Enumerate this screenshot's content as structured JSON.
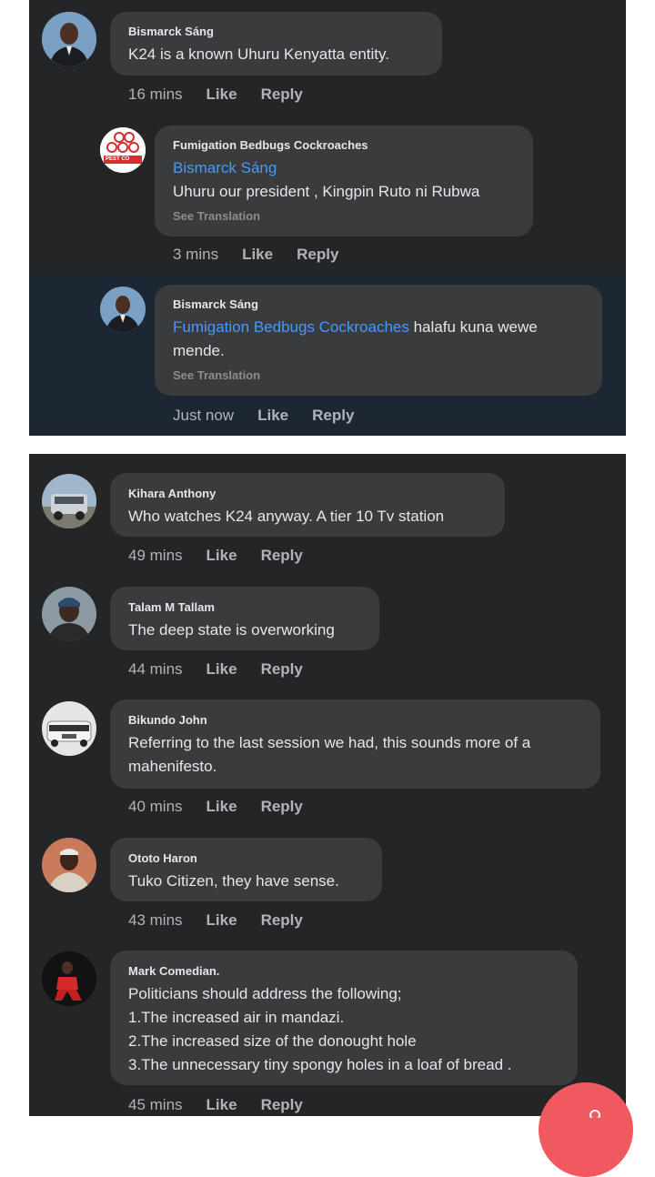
{
  "panel1": {
    "comments": [
      {
        "author": "Bismarck Sáng",
        "text": "K24 is a known Uhuru Kenyatta entity.",
        "time": "16 mins",
        "like": "Like",
        "reply": "Reply"
      },
      {
        "author": "Fumigation Bedbugs Cockroaches",
        "mention": "Bismarck Sáng",
        "text": "Uhuru our president , Kingpin Ruto ni Rubwa",
        "see_translation": "See Translation",
        "time": "3 mins",
        "like": "Like",
        "reply": "Reply",
        "avatar_label": "PEST CO"
      },
      {
        "author": "Bismarck Sáng",
        "mention": "Fumigation Bedbugs Cockroaches",
        "text_line1_rest": " halafu kuna wewe",
        "text_line2": "mende.",
        "see_translation": "See Translation",
        "time": "Just now",
        "like": "Like",
        "reply": "Reply"
      }
    ]
  },
  "panel2": {
    "comments": [
      {
        "author": "Kihara Anthony",
        "text": "Who watches K24 anyway. A tier 10 Tv station",
        "time": "49 mins",
        "like": "Like",
        "reply": "Reply"
      },
      {
        "author": "Talam M Tallam",
        "text": "The deep state is overworking",
        "time": "44 mins",
        "like": "Like",
        "reply": "Reply"
      },
      {
        "author": "Bikundo John",
        "line1": "Referring to the last session we had, this sounds more of a",
        "line2": "mahenifesto.",
        "time": "40 mins",
        "like": "Like",
        "reply": "Reply"
      },
      {
        "author": "Ototo Haron",
        "text": "Tuko Citizen, they have sense.",
        "time": "43 mins",
        "like": "Like",
        "reply": "Reply"
      },
      {
        "author": "Mark Comedian.",
        "line1": "Politicians should address the following;",
        "line2": "1.The increased air in mandazi.",
        "line3": "2.The increased size of the donought hole",
        "line4": "3.The unnecessary tiny spongy holes in a loaf of bread .",
        "time": "45 mins",
        "like": "Like",
        "reply": "Reply"
      }
    ]
  },
  "colors": {
    "background": "#242526",
    "bubble": "#3a3b3c",
    "highlight": "#1d2734",
    "mention": "#4599ff",
    "text": "#e4e6eb",
    "muted": "#b0b3b8",
    "fab": "#f0595e"
  }
}
